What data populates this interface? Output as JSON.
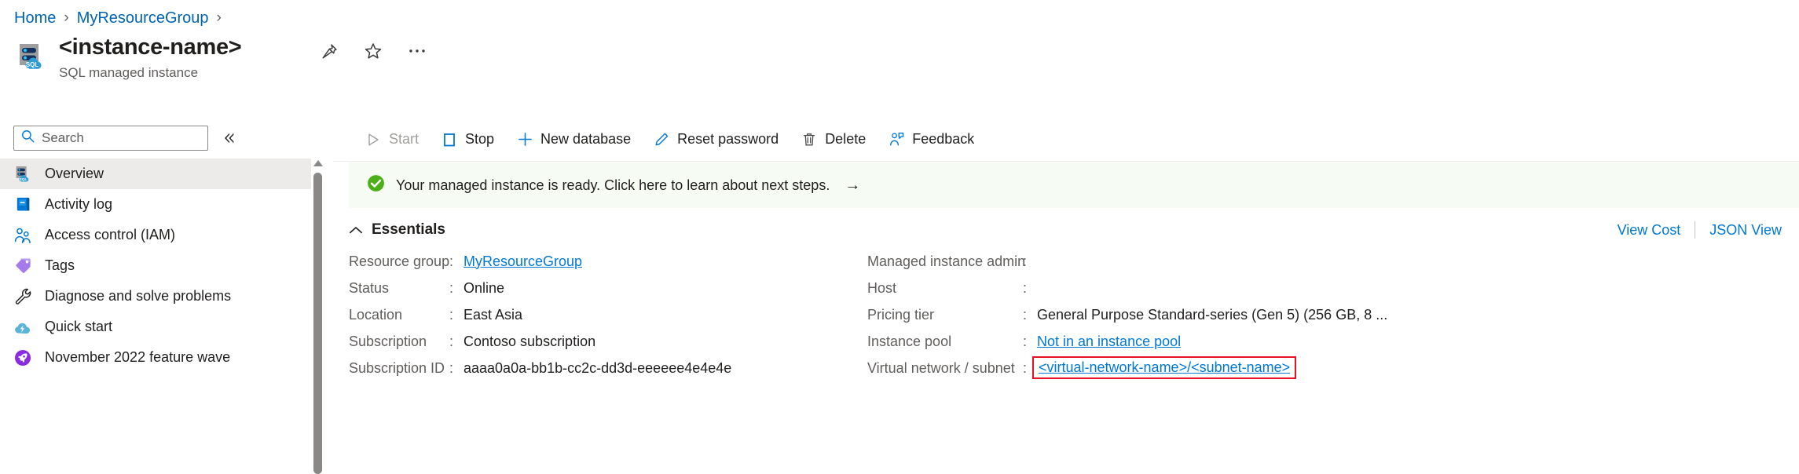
{
  "breadcrumb": {
    "items": [
      {
        "label": "Home"
      },
      {
        "label": "MyResourceGroup"
      }
    ],
    "separator": "›"
  },
  "resource": {
    "title": "<instance-name>",
    "subtitle": "SQL managed instance",
    "icon": "sql-managed-instance-icon",
    "actions": [
      {
        "name": "pin-icon",
        "label": "Pin"
      },
      {
        "name": "favorite-star-icon",
        "label": "Add to favorites"
      },
      {
        "name": "more-ellipsis-icon",
        "label": "More"
      }
    ]
  },
  "sidebar": {
    "search": {
      "placeholder": "Search",
      "value": "",
      "icon": "search-icon"
    },
    "collapse": {
      "label": "«",
      "name": "collapse-rail-icon"
    },
    "items": [
      {
        "label": "Overview",
        "icon": "sql-managed-instance-icon",
        "selected": true
      },
      {
        "label": "Activity log",
        "icon": "activity-log-icon",
        "selected": false
      },
      {
        "label": "Access control (IAM)",
        "icon": "access-control-icon",
        "selected": false
      },
      {
        "label": "Tags",
        "icon": "tag-icon",
        "selected": false
      },
      {
        "label": "Diagnose and solve problems",
        "icon": "wrench-icon",
        "selected": false
      },
      {
        "label": "Quick start",
        "icon": "quick-start-cloud-icon",
        "selected": false
      },
      {
        "label": "November 2022 feature wave",
        "icon": "rocket-icon",
        "selected": false
      }
    ]
  },
  "toolbar": {
    "buttons": [
      {
        "label": "Start",
        "icon": "play-icon",
        "disabled": true
      },
      {
        "label": "Stop",
        "icon": "stop-square-icon",
        "disabled": false
      },
      {
        "label": "New database",
        "icon": "plus-icon",
        "disabled": false
      },
      {
        "label": "Reset password",
        "icon": "pencil-icon",
        "disabled": false
      },
      {
        "label": "Delete",
        "icon": "trash-icon",
        "disabled": false
      },
      {
        "label": "Feedback",
        "icon": "feedback-person-icon",
        "disabled": false
      }
    ]
  },
  "banner": {
    "icon": "success-check-icon",
    "text": "Your managed instance is ready. Click here to learn about next steps.",
    "arrow": "→",
    "background": "#f6fbf3",
    "icon_color": "#4caf17"
  },
  "essentials": {
    "title": "Essentials",
    "chevron": "⌃",
    "expanded": true,
    "view_cost_label": "View Cost",
    "json_view_label": "JSON View",
    "left_properties": [
      {
        "key": "Resource group",
        "value": "MyResourceGroup",
        "is_link": true
      },
      {
        "key": "Status",
        "value": "Online",
        "is_link": false
      },
      {
        "key": "Location",
        "value": "East Asia",
        "is_link": false
      },
      {
        "key": "Subscription",
        "value": "Contoso subscription",
        "is_link": false
      },
      {
        "key": "Subscription ID",
        "value": "aaaa0a0a-bb1b-cc2c-dd3d-eeeeee4e4e4e",
        "is_link": false
      }
    ],
    "right_properties": [
      {
        "key": "Managed instance admin",
        "value": "",
        "is_link": false
      },
      {
        "key": "Host",
        "value": "",
        "is_link": false
      },
      {
        "key": "Pricing tier",
        "value": "General Purpose Standard-series (Gen 5) (256 GB, 8 ...",
        "is_link": false
      },
      {
        "key": "Instance pool",
        "value": "Not in an instance pool",
        "is_link": true
      },
      {
        "key": "Virtual network / subnet",
        "value": "<virtual-network-name>/<subnet-name>",
        "is_link": true,
        "highlighted": true
      }
    ]
  },
  "colors": {
    "link": "#0078d4",
    "breadcrumb_link": "#0063b1",
    "highlight_box": "#e81123",
    "selected_row": "#edebe9",
    "text": "#201f1e",
    "muted_text": "#605e5c"
  }
}
